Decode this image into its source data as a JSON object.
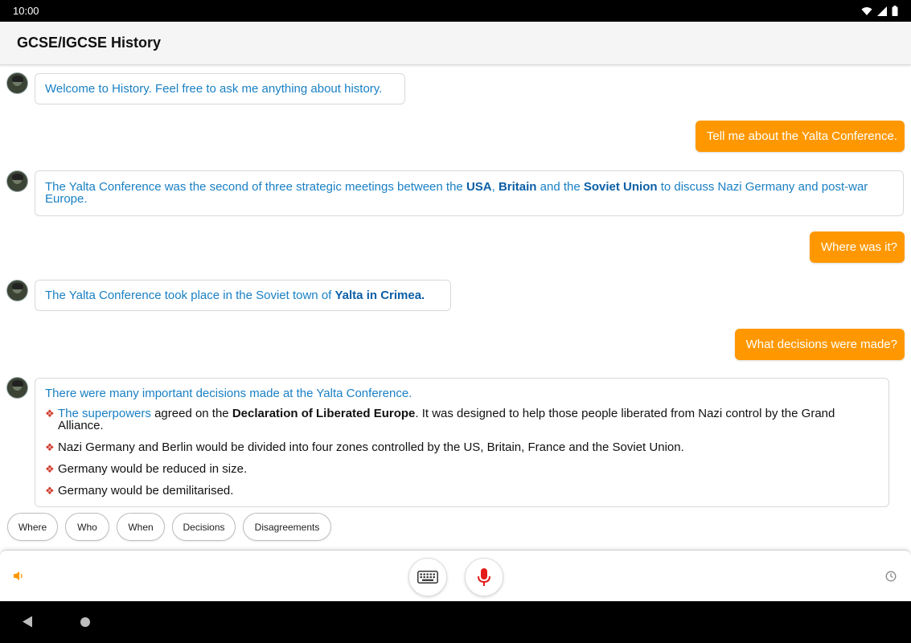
{
  "status_bar": {
    "time": "10:00"
  },
  "app_bar": {
    "title": "GCSE/IGCSE History"
  },
  "messages": {
    "m1": {
      "text": "Welcome to History. Feel free to ask me anything about history."
    },
    "m2": {
      "text": "Tell me about the Yalta Conference."
    },
    "m3": {
      "t1": "The Yalta Conference was the second of three strategic meetings between the ",
      "b1": "USA",
      "t2": ", ",
      "b2": "Britain",
      "t3": " and the ",
      "b3": "Soviet Union",
      "t4": " to discuss Nazi Germany and post-war Europe."
    },
    "m4": {
      "text": "Where was it?"
    },
    "m5": {
      "t1": "The Yalta Conference took place in the Soviet town of ",
      "b1": "Yalta in Crimea."
    },
    "m6": {
      "text": "What decisions were made?"
    },
    "m7": {
      "intro": "There were many important decisions made at the Yalta Conference.",
      "bullet1": {
        "link": "The superpowers",
        "t1": " agreed on the ",
        "b1": "Declaration of Liberated Europe",
        "t2": ". It was designed to help those people liberated from Nazi control by the Grand Alliance."
      },
      "bullet2": "Nazi Germany and Berlin would be divided into four zones controlled by the US, Britain, France and the Soviet Union.",
      "bullet3": "Germany would be reduced in size.",
      "bullet4": "Germany would be demilitarised."
    }
  },
  "chips": [
    "Where",
    "Who",
    "When",
    "Decisions",
    "Disagreements"
  ],
  "input_bar": {
    "accent": "#ff9800",
    "mic_color": "#e31b1b"
  },
  "icons": [
    "wifi-icon",
    "signal-icon",
    "battery-icon",
    "speaker-icon",
    "keyboard-icon",
    "microphone-icon",
    "clock-icon",
    "back-icon",
    "home-icon"
  ]
}
